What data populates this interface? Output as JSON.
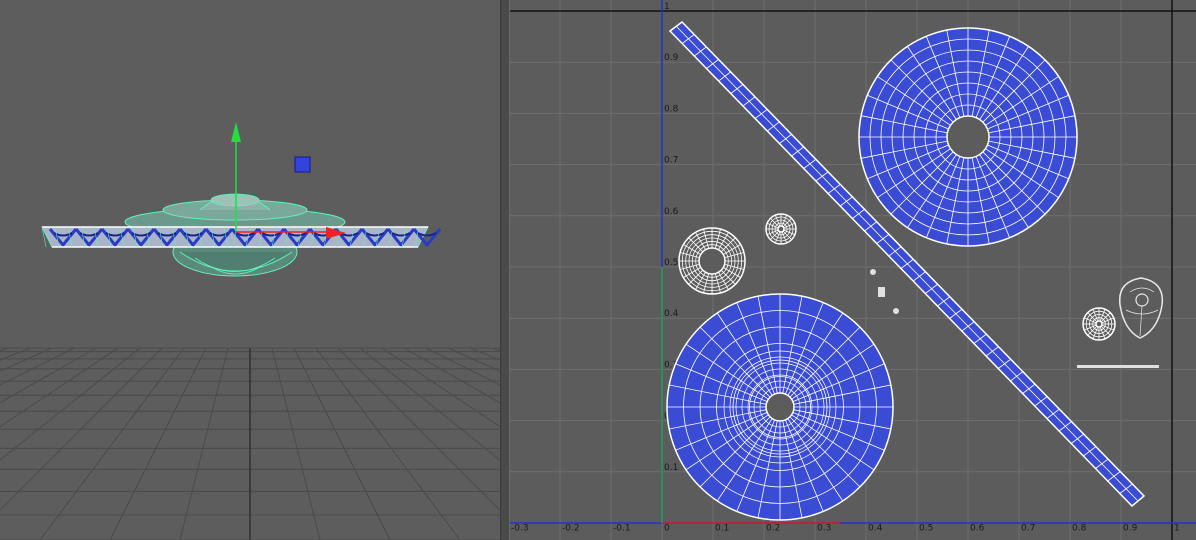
{
  "viewport3d": {
    "model": "flying-saucer mesh",
    "manipulator": {
      "y_axis_color": "#22dd44",
      "x_axis_color": "#ee2222",
      "handle_color": "#3344dd"
    },
    "wireframe_color": "#66eebb",
    "texture_color": "#3a4bd4"
  },
  "uv_editor": {
    "uv_fill_color": "#3a4bd4",
    "edge_color": "#ffffff",
    "grid_color": "#6e6e6e",
    "u_axis_color": "#cc2222",
    "v_axis_color": "#2233cc",
    "u_ticks": [
      "-0.3",
      "-0.2",
      "-0.1",
      "0",
      "0.1",
      "0.2",
      "0.3",
      "0.4",
      "0.5",
      "0.6",
      "0.7",
      "0.8",
      "0.9",
      "1"
    ],
    "v_ticks": [
      "0.1",
      "0.2",
      "0.3",
      "0.4",
      "0.5",
      "0.6",
      "0.7",
      "0.8",
      "0.9",
      "1"
    ]
  }
}
